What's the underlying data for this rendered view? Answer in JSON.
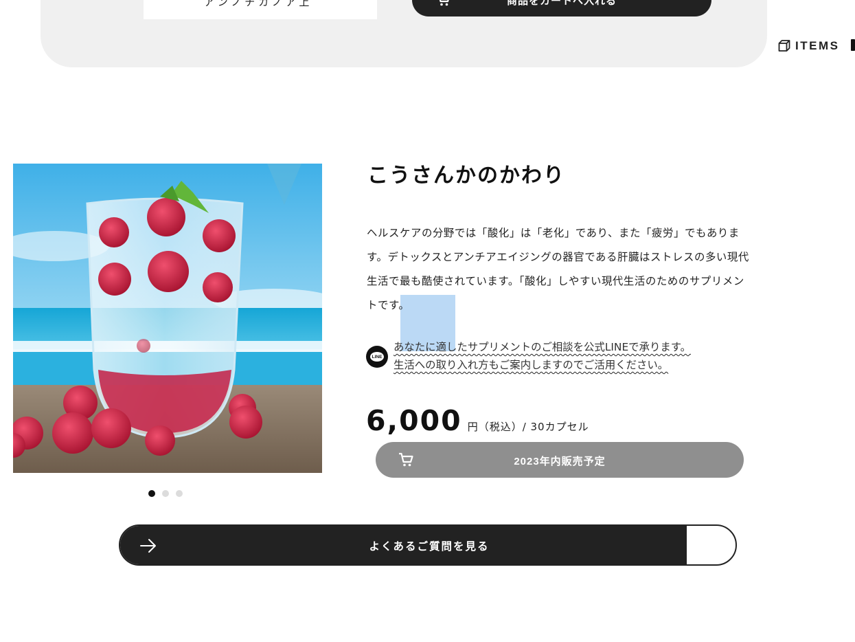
{
  "top_panel": {
    "select_text": "ア ン ノ  チ カ ノ ア  上  ",
    "cart_button_label": "商品をカートへ入れる",
    "cart_icon": "cart-icon"
  },
  "side_nav": {
    "items_label": "ITEMS",
    "items_icon": "cube-icon"
  },
  "product": {
    "title": "こうさんかのかわり",
    "description": "ヘルスケアの分野では「酸化」は「老化」であり、また「疲労」でもあります。デトックスとアンチアエイジングの器官である肝臓はストレスの多い現代生活で最も酷使されています。「酸化」しやすい現代生活のためのサプリメントです。",
    "line_note_line1": "あなたに適したサプリメントのご相談を公式LINEで承ります。",
    "line_note_line2": "生活への取り入れ方もご案内しますのでご活用ください。",
    "line_icon_text": "LINE",
    "price": "6,000",
    "price_unit": "円（税込）/ 30カプセル",
    "cart_button_label": "2023年内販売予定",
    "cart_icon": "cart-icon",
    "image_slides": 3,
    "active_slide": 1
  },
  "faq_button": {
    "label": "よくあるご質問を見る",
    "icon": "arrow-right-icon"
  },
  "colors": {
    "dark": "#222222",
    "panel_bg": "#f0f0f0",
    "disabled_button": "#8f8f8f",
    "selection": "#b8d8f6",
    "raspberry": "#c0203e",
    "sky": "#66c4ee"
  }
}
